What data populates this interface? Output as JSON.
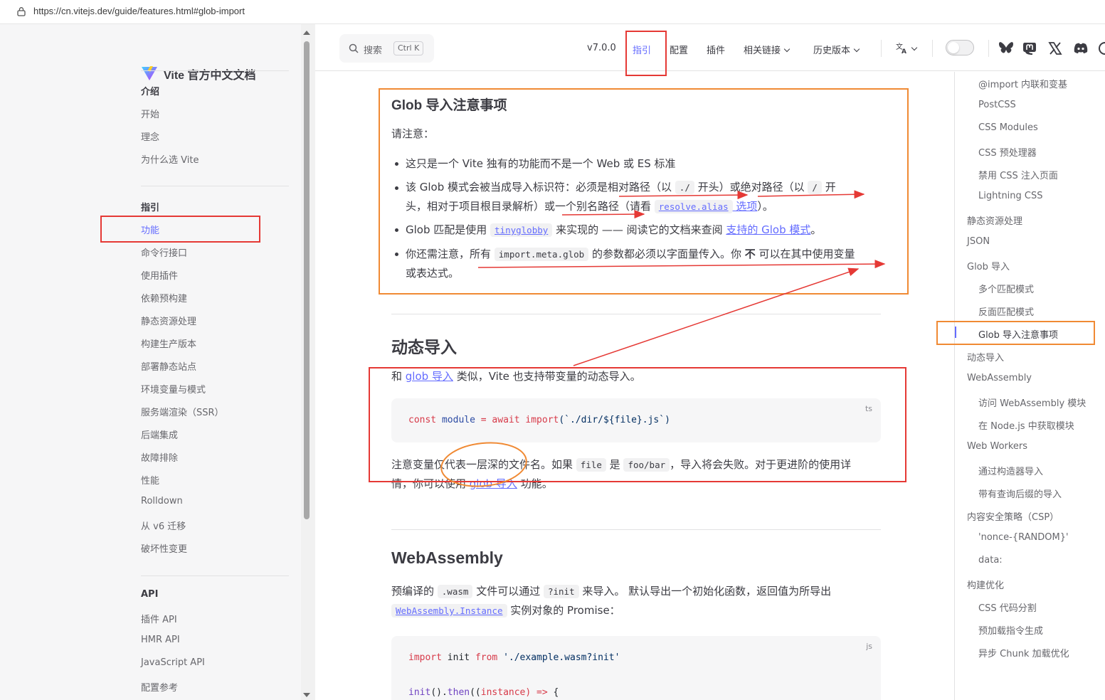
{
  "browser": {
    "url": "https://cn.vitejs.dev/guide/features.html#glob-import"
  },
  "sidebar": {
    "site_title": "Vite 官方中文文档",
    "sections": [
      {
        "title": "介绍",
        "items": [
          "开始",
          "理念",
          "为什么选 Vite"
        ]
      },
      {
        "title": "指引",
        "items": [
          "功能",
          "命令行接口",
          "使用插件",
          "依赖预构建",
          "静态资源处理",
          "构建生产版本",
          "部署静态站点",
          "环境变量与模式",
          "服务端渲染（SSR）",
          "后端集成",
          "故障排除",
          "性能",
          "Rolldown",
          "从 v6 迁移",
          "破坏性变更"
        ]
      },
      {
        "title": "API",
        "items": [
          "插件 API",
          "HMR API",
          "JavaScript API",
          "配置参考"
        ]
      }
    ]
  },
  "nav": {
    "search_label": "搜索",
    "search_kbd": "Ctrl K",
    "version": "v7.0.0",
    "items": [
      "指引",
      "配置",
      "插件",
      "相关链接",
      "历史版本"
    ],
    "lang_icon": "translate-icon",
    "socials": [
      "bluesky-icon",
      "mastodon-icon",
      "x-icon",
      "discord-icon",
      "github-icon"
    ]
  },
  "content": {
    "glob_caveats": {
      "heading": "Glob 导入注意事项",
      "intro": "请注意：",
      "items": {
        "i1": "这只是一个 Vite 独有的功能而不是一个 Web 或 ES 标准",
        "i2_a": "该 Glob 模式会被当成导入标识符：必须是相对路径（以 ",
        "i2_code1": "./",
        "i2_b": " 开头）或绝对路径（以 ",
        "i2_code2": "/",
        "i2_c": " 开",
        "i2_d": "头，相对于项目根目录解析）或一个别名路径（请看 ",
        "i2_code3": "resolve.alias",
        "i2_link": " 选项",
        "i2_e": "）。",
        "i3_a": "Glob 匹配是使用 ",
        "i3_code": "tinyglobby",
        "i3_b": " 来实现的 —— 阅读它的文档来查阅 ",
        "i3_link": "支持的 Glob 模式",
        "i3_c": "。",
        "i4_a": "你还需注意，所有 ",
        "i4_code": "import.meta.glob",
        "i4_b": " 的参数都必须以字面量传入。你 ",
        "i4_strong": "不",
        "i4_c": " 可以在其中使用变量",
        "i4_d": "或表达式。"
      }
    },
    "dynamic_import": {
      "heading": "动态导入",
      "p1_a": "和 ",
      "p1_link": "glob 导入",
      "p1_b": " 类似，Vite 也支持带变量的动态导入。",
      "code_lang": "ts",
      "code": {
        "t1": "const",
        "t2": "module",
        "t3": "=",
        "t4": "await",
        "t5": "import",
        "t6": "(`./dir/${file}.js`)"
      },
      "p2_a": "注意变量仅代表一层深的文件名。如果 ",
      "p2_code1": "file",
      "p2_b": " 是 ",
      "p2_code2": "foo/bar",
      "p2_c": "，导入将会失败。对于更进阶的使用详",
      "p2_d": "情，你可以使用 ",
      "p2_link": "glob 导入",
      "p2_e": " 功能。"
    },
    "webassembly": {
      "heading": "WebAssembly",
      "p1_a": "预编译的 ",
      "p1_code1": ".wasm",
      "p1_b": " 文件可以通过 ",
      "p1_code2": "?init",
      "p1_c": " 来导入。 默认导出一个初始化函数，返回值为所导出",
      "p1_code3": "WebAssembly.Instance",
      "p1_d": " 实例对象的 Promise：",
      "code_lang": "js",
      "code1": {
        "t1": "import",
        "t2": "init",
        "t3": "from",
        "t4": "'./example.wasm?init'"
      },
      "code2": {
        "t1": "init",
        "t2": "().",
        "t3": "then",
        "t4": "((",
        "t5": "instance",
        "t6": ") =>",
        "t7": " {"
      }
    }
  },
  "outline": {
    "items": [
      {
        "label": "@import 内联和变基",
        "level": 2
      },
      {
        "label": "PostCSS",
        "level": 2
      },
      {
        "label": "CSS Modules",
        "level": 2
      },
      {
        "label": "CSS 预处理器",
        "level": 2
      },
      {
        "label": "禁用 CSS 注入页面",
        "level": 2
      },
      {
        "label": "Lightning CSS",
        "level": 2
      },
      {
        "label": "静态资源处理",
        "level": 1
      },
      {
        "label": "JSON",
        "level": 1
      },
      {
        "label": "Glob 导入",
        "level": 1
      },
      {
        "label": "多个匹配模式",
        "level": 2
      },
      {
        "label": "反面匹配模式",
        "level": 2
      },
      {
        "label": "Glob 导入注意事项",
        "level": 2
      },
      {
        "label": "动态导入",
        "level": 1
      },
      {
        "label": "WebAssembly",
        "level": 1
      },
      {
        "label": "访问 WebAssembly 模块",
        "level": 2
      },
      {
        "label": "在 Node.js 中获取模块",
        "level": 2
      },
      {
        "label": "Web Workers",
        "level": 1
      },
      {
        "label": "通过构造器导入",
        "level": 2
      },
      {
        "label": "带有查询后缀的导入",
        "level": 2
      },
      {
        "label": "内容安全策略（CSP）",
        "level": 1
      },
      {
        "label": "'nonce-{RANDOM}'",
        "level": 2
      },
      {
        "label": "data:",
        "level": 2
      },
      {
        "label": "构建优化",
        "level": 1
      },
      {
        "label": "CSS 代码分割",
        "level": 2
      },
      {
        "label": "预加载指令生成",
        "level": 2
      },
      {
        "label": "异步 Chunk 加载优化",
        "level": 2
      }
    ],
    "active_index": 11
  },
  "colors": {
    "brand": "#646cff",
    "annotation_red": "#e53935",
    "annotation_orange": "#f08a34"
  }
}
